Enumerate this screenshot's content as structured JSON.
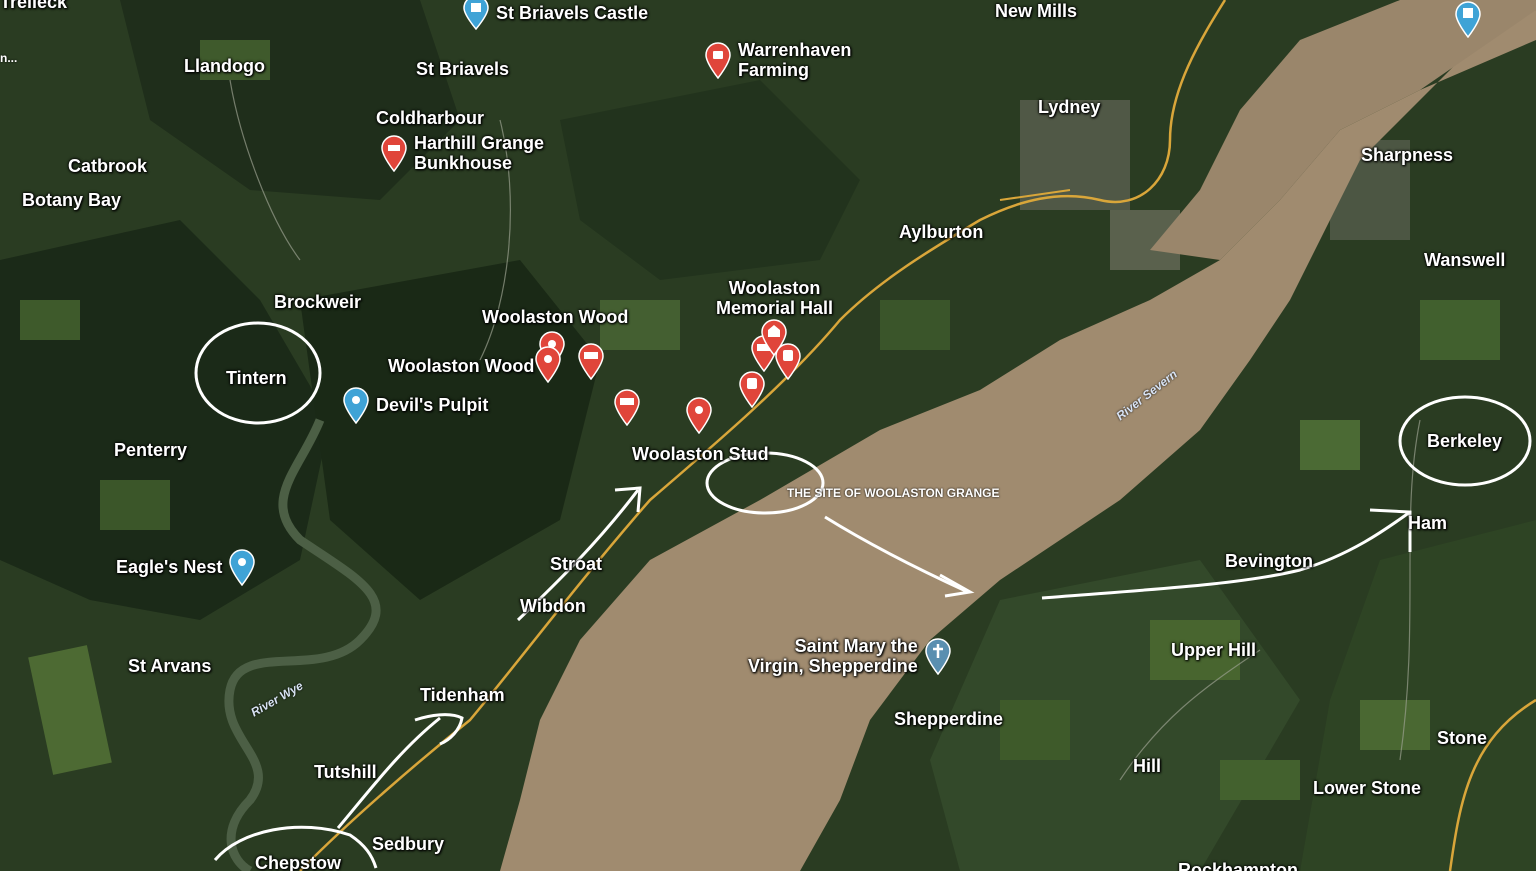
{
  "colors": {
    "land_dark": "#24351f",
    "forest": "#1d2c1a",
    "field": "#4b6232",
    "estuary": "#a08c70",
    "road": "#d9a63a",
    "pin_red": "#e0453a",
    "pin_blue": "#3fa3d6",
    "annotation": "#ffffff"
  },
  "places": {
    "tintern_top": "Trelleck",
    "llandogo": "Llandogo",
    "st_briavels": "St Briavels",
    "st_briavels_castle": "St Briavels Castle",
    "warrenhaven": "Warrenhaven\nFarming",
    "new_mills": "New Mills",
    "lydney": "Lydney",
    "coldharbour": "Coldharbour",
    "harthill": "Harthill Grange\nBunkhouse",
    "catbrook": "Catbrook",
    "botany_bay": "Botany Bay",
    "sharpness": "Sharpness",
    "aylburton": "Aylburton",
    "wanswell": "Wanswell",
    "brockweir": "Brockweir",
    "woolaston_memorial": "Woolaston\nMemorial Hall",
    "woolaston_wood_1": "Woolaston Wood",
    "woolaston_wood_2": "Woolaston Wood",
    "tintern": "Tintern",
    "devils_pulpit": "Devil's Pulpit",
    "penterry": "Penterry",
    "woolaston_stud": "Woolaston Stud",
    "berkeley": "Berkeley",
    "grange_site": "THE SITE OF WOOLASTON GRANGE",
    "ham": "Ham",
    "bevington": "Bevington",
    "eagles_nest": "Eagle's Nest",
    "stroat": "Stroat",
    "wibdon": "Wibdon",
    "saint_mary": "Saint Mary the\nVirgin, Shepperdine",
    "upper_hill": "Upper Hill",
    "st_arvans": "St Arvans",
    "tidenham": "Tidenham",
    "shepperdine": "Shepperdine",
    "stone": "Stone",
    "tutshill": "Tutshill",
    "hill": "Hill",
    "lower_stone": "Lower Stone",
    "sedbury": "Sedbury",
    "chepstow": "Chepstow",
    "rockhampton": "Rockhampton",
    "left_cut": "n..."
  },
  "rivers": {
    "severn": "River Severn",
    "wye": "River Wye"
  }
}
